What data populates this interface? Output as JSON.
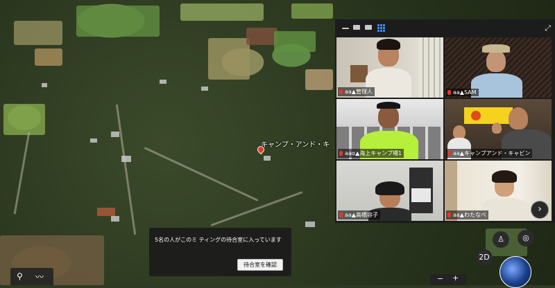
{
  "map": {
    "place_label": "キャンプ・アンド・キ"
  },
  "zoom": {
    "toolbar_icons": [
      "minimize-icon",
      "window-icon",
      "filmstrip-icon",
      "gallery-view-icon",
      "fullscreen-icon"
    ],
    "participants": [
      {
        "name": "aa▲管理人"
      },
      {
        "name": "aa▲SAM"
      },
      {
        "name": "aaα▲海上キャンプ場1"
      },
      {
        "name": "aa▲キャンプアンド・キャビン"
      },
      {
        "name": "aa▲高橋容子"
      },
      {
        "name": "aa▲わたなべ"
      }
    ],
    "next_page_glyph": "›"
  },
  "waiting_room": {
    "message": "5名の人がこのミ ティングの待合室に入っています",
    "button_label": "待合室を確認"
  },
  "map_controls": {
    "view_label": "2D",
    "zoom_minus": "−",
    "zoom_plus": "+"
  }
}
